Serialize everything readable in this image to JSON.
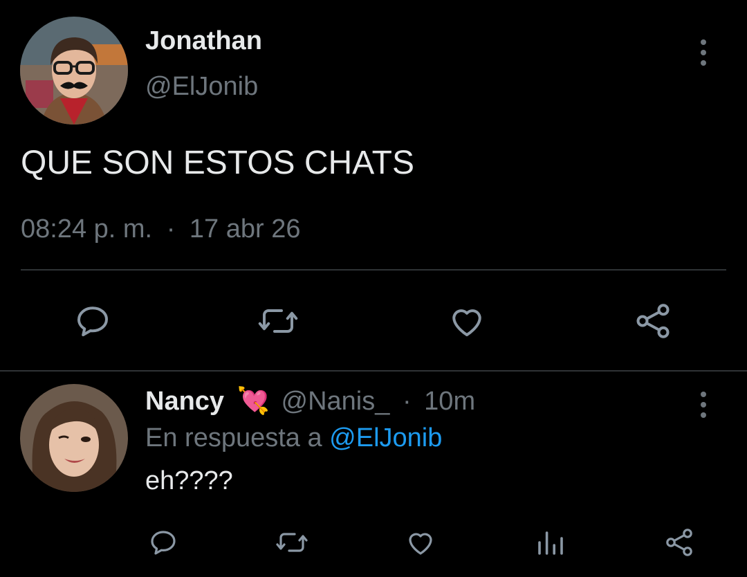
{
  "main_tweet": {
    "display_name": "Jonathan",
    "handle": "@ElJonib",
    "text": "QUE SON ESTOS CHATS",
    "time": "08:24 p. m.",
    "separator": "·",
    "date": "17 abr 26",
    "avatar_icon": "person-with-glasses-and-mustache-avatar",
    "actions": [
      "reply-icon",
      "retweet-icon",
      "like-icon",
      "share-icon"
    ]
  },
  "reply": {
    "display_name": "Nancy",
    "emoji": "💘",
    "handle": "@Nanis_",
    "separator": "·",
    "age": "10m",
    "in_reply_to_prefix": "En respuesta a",
    "in_reply_to_handle": "@ElJonib",
    "text": "eh????",
    "avatar_icon": "woman-winking-avatar",
    "actions": [
      "reply-icon",
      "retweet-icon",
      "like-icon",
      "analytics-icon",
      "share-icon"
    ]
  },
  "colors": {
    "background": "#000000",
    "text": "#e7e9ea",
    "muted": "#6e767d",
    "link": "#1d9bf0",
    "divider": "#2f3336"
  }
}
